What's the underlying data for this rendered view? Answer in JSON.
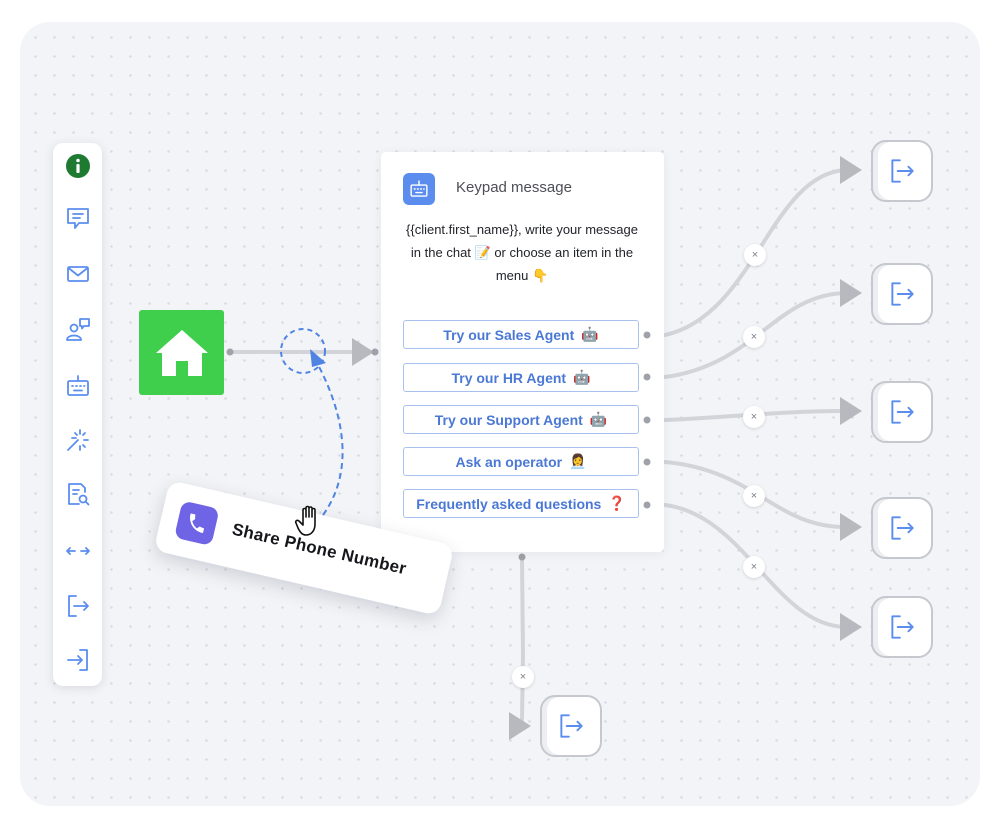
{
  "node_title": "Keypad message",
  "message": "{{client.first_name}}, write your message in the chat 📝 or choose an item in the menu 👇",
  "menu_items": [
    {
      "label": "Try our Sales Agent",
      "emoji": "🤖"
    },
    {
      "label": "Try our HR Agent",
      "emoji": "🤖"
    },
    {
      "label": "Try our Support Agent",
      "emoji": "🤖"
    },
    {
      "label": "Ask an operator",
      "emoji": "👩‍💼"
    },
    {
      "label": "Frequently asked questions",
      "emoji": "❓"
    }
  ],
  "drag_card": {
    "label": "Share Phone Number"
  },
  "badge_symbol": "×",
  "colors": {
    "start_node": "#3fcf4d",
    "accent_blue": "#5b8def",
    "button_text": "#4a78d4",
    "button_border": "#a9c1ef",
    "phone_icon": "#6f63e6",
    "wire": "#d2d4d9",
    "info_green": "#1e7a31"
  },
  "toolbar_icons": [
    "info-icon",
    "chat-message-icon",
    "email-icon",
    "operator-chat-icon",
    "keypad-icon",
    "ai-sparkle-icon",
    "document-search-icon",
    "arrows-horizontal-icon",
    "exit-icon",
    "enter-icon"
  ],
  "exit_icon": "exit-icon"
}
